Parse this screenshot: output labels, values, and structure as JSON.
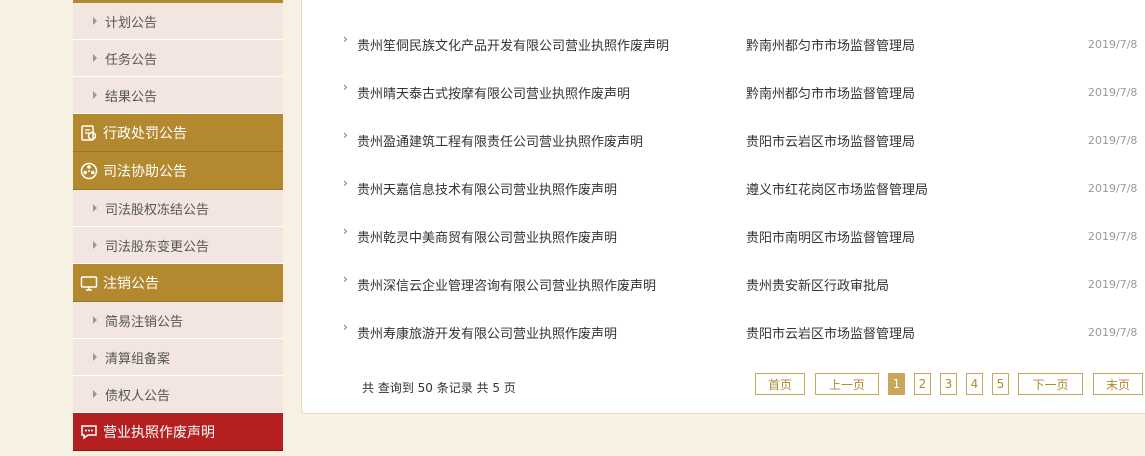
{
  "sidebar": {
    "sub_items_top": [
      "计划公告",
      "任务公告",
      "结果公告"
    ],
    "cat_admin": "行政处罚公告",
    "cat_judicial": "司法协助公告",
    "sub_items_judicial": [
      "司法股权冻结公告",
      "司法股东变更公告"
    ],
    "cat_cancel": "注销公告",
    "sub_items_cancel": [
      "简易注销公告",
      "清算组备案",
      "债权人公告"
    ],
    "cat_license": "营业执照作废声明"
  },
  "notices": [
    {
      "title": "贵州笙侗民族文化产品开发有限公司营业执照作废声明",
      "agency": "黔南州都匀市市场监督管理局",
      "date": "2019/7/8"
    },
    {
      "title": "贵州晴天泰古式按摩有限公司营业执照作废声明",
      "agency": "黔南州都匀市市场监督管理局",
      "date": "2019/7/8"
    },
    {
      "title": "贵州盈通建筑工程有限责任公司营业执照作废声明",
      "agency": "贵阳市云岩区市场监督管理局",
      "date": "2019/7/8"
    },
    {
      "title": "贵州天嘉信息技术有限公司营业执照作废声明",
      "agency": "遵义市红花岗区市场监督管理局",
      "date": "2019/7/8"
    },
    {
      "title": "贵州乾灵中美商贸有限公司营业执照作废声明",
      "agency": "贵阳市南明区市场监督管理局",
      "date": "2019/7/8"
    },
    {
      "title": "贵州深信云企业管理咨询有限公司营业执照作废声明",
      "agency": "贵州贵安新区行政审批局",
      "date": "2019/7/8"
    },
    {
      "title": "贵州寿康旅游开发有限公司营业执照作废声明",
      "agency": "贵阳市云岩区市场监督管理局",
      "date": "2019/7/8"
    }
  ],
  "pagination": {
    "summary": "共 查询到 50 条记录 共 5 页",
    "first": "首页",
    "prev": "上一页",
    "pages": [
      "1",
      "2",
      "3",
      "4",
      "5"
    ],
    "next": "下一页",
    "last": "末页"
  }
}
